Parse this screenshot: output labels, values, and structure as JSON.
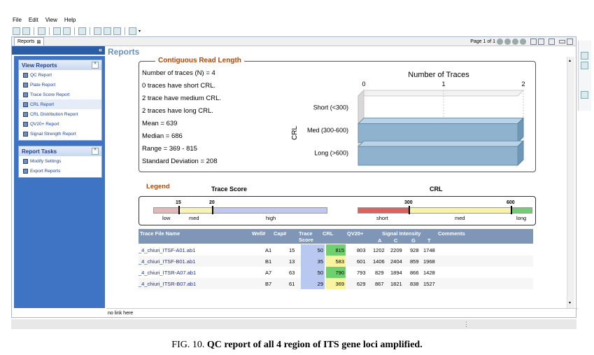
{
  "menu": {
    "items": [
      "File",
      "Edit",
      "View",
      "Help"
    ]
  },
  "tab": {
    "label": "Reports"
  },
  "pager": {
    "text": "Page 1 of 1"
  },
  "nav": {
    "view_reports": {
      "title": "View Reports",
      "items": [
        {
          "label": "QC Report"
        },
        {
          "label": "Plate Report"
        },
        {
          "label": "Trace Score Report"
        },
        {
          "label": "CRL Report"
        },
        {
          "label": "CRL Distribution Report"
        },
        {
          "label": "QV20+ Report"
        },
        {
          "label": "Signal Strength Report"
        }
      ]
    },
    "report_tasks": {
      "title": "Report Tasks",
      "items": [
        {
          "label": "Modify Settings"
        },
        {
          "label": "Export Reports"
        }
      ]
    }
  },
  "main": {
    "title": "Reports"
  },
  "crl": {
    "title": "Contiguous Read Length",
    "stats": [
      "Number of traces (N) = 4",
      "0 traces have short CRL.",
      "2 trace have medium CRL.",
      "2 traces have long CRL.",
      "Mean = 639",
      "Median = 686",
      "Range = 369 - 815",
      "Standard Deviation = 208"
    ]
  },
  "chart_data": {
    "type": "bar",
    "orientation": "horizontal",
    "title": "Number of Traces",
    "ylabel": "CRL",
    "xlabel": "",
    "categories": [
      "Short (<300)",
      "Med (300-600)",
      "Long (>600)"
    ],
    "values": [
      0,
      2,
      2
    ],
    "xlim": [
      0,
      2
    ],
    "xticks": [
      "0",
      "1",
      "2"
    ],
    "bar_color": "#8fb3cf",
    "style": "3d"
  },
  "legend": {
    "title": "Legend",
    "trace_score": {
      "label": "Trace Score",
      "thresholds": [
        "15",
        "20"
      ],
      "ranges": [
        "low",
        "med",
        "high"
      ],
      "colors": [
        "#e0b8b8",
        "#f8f4b0",
        "#c0c8f0"
      ]
    },
    "crl": {
      "label": "CRL",
      "thresholds": [
        "300",
        "600"
      ],
      "ranges": [
        "short",
        "med",
        "long"
      ],
      "colors": [
        "#e06060",
        "#f8f4a0",
        "#70d070"
      ]
    }
  },
  "table": {
    "headers": {
      "file": "Trace File Name",
      "well": "Well#",
      "cap": "Cap#",
      "ts1": "Trace",
      "ts2": "Score",
      "crl": "CRL",
      "qv": "QV20+",
      "sig": "Signal Intensity",
      "a": "A",
      "c": "C",
      "g": "G",
      "t": "T",
      "comments": "Comments"
    },
    "rows": [
      {
        "file": "_4_chiuri_ITSF-A01.ab1",
        "well": "A1",
        "cap": "15",
        "ts": "50",
        "crl": "815",
        "crl_color": "#70d070",
        "qv": "803",
        "a": "1202",
        "c": "2209",
        "g": "928",
        "t": "1748"
      },
      {
        "file": "_4_chiuri_ITSF-B01.ab1",
        "well": "B1",
        "cap": "13",
        "ts": "35",
        "crl": "583",
        "crl_color": "#f8f4a0",
        "qv": "601",
        "a": "1406",
        "c": "2404",
        "g": "859",
        "t": "1968"
      },
      {
        "file": "_4_chiuri_ITSR-A07.ab1",
        "well": "A7",
        "cap": "63",
        "ts": "50",
        "crl": "790",
        "crl_color": "#70d070",
        "qv": "793",
        "a": "829",
        "c": "1894",
        "g": "866",
        "t": "1428"
      },
      {
        "file": "_4_chiuri_ITSR-B07.ab1",
        "well": "B7",
        "cap": "61",
        "ts": "29",
        "crl": "369",
        "crl_color": "#f8f4a0",
        "qv": "629",
        "a": "867",
        "c": "1821",
        "g": "838",
        "t": "1527"
      }
    ]
  },
  "status": {
    "text": "no link here"
  },
  "caption": {
    "prefix": "FIG. 10.",
    "text": "QC report of all 4 region of ITS gene loci amplified."
  }
}
